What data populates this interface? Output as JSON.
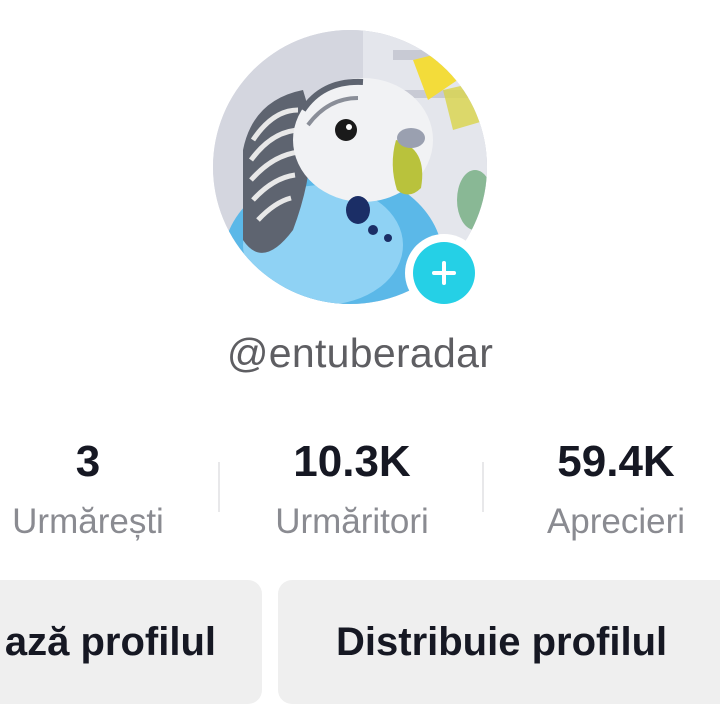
{
  "profile": {
    "username": "@entuberadar",
    "avatar_icon": "budgie-photo",
    "add_icon": "plus-icon",
    "accent_color": "#25d0e6"
  },
  "stats": [
    {
      "value": "3",
      "label": "Urmărești"
    },
    {
      "value": "10.3K",
      "label": "Urmăritori"
    },
    {
      "value": "59.4K",
      "label": "Aprecieri"
    }
  ],
  "buttons": {
    "edit_label": "ază profilul",
    "share_label": "Distribuie profilul"
  }
}
